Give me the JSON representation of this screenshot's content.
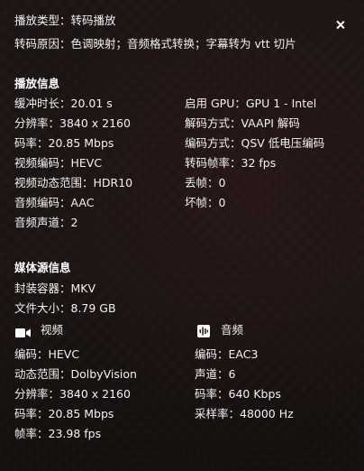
{
  "header": {
    "playback_type": "播放类型：转码播放",
    "transcode_reason": "转码原因：色调映射；音频格式转换；字幕转为 vtt 切片"
  },
  "playback_info": {
    "title": "播放信息",
    "left": [
      "缓冲时长：20.01 s",
      "分辨率：3840 x 2160",
      "码率：20.85 Mbps",
      "视频编码：HEVC",
      "视频动态范围：HDR10",
      "音频编码：AAC",
      "音频声道：2"
    ],
    "right": [
      "启用 GPU：GPU 1 - Intel",
      "解码方式：VAAPI 解码",
      "编码方式：QSV 低电压编码",
      "转码帧率：32 fps",
      "丢帧：0",
      "坏帧：0"
    ]
  },
  "media_source": {
    "title": "媒体源信息",
    "container": "封装容器：MKV",
    "file_size": "文件大小：8.79 GB",
    "video": {
      "label": "视频",
      "icon": "video-camera-icon",
      "rows": [
        "编码：HEVC",
        "动态范围：DolbyVision",
        "分辨率：3840 x 2160",
        "码率：20.85 Mbps",
        "帧率：23.98 fps"
      ]
    },
    "audio": {
      "label": "音频",
      "icon": "audio-waveform-icon",
      "rows": [
        "编码：EAC3",
        "声道：6",
        "码率：640 Kbps",
        "采样率：48000 Hz"
      ]
    }
  },
  "close_icon": "close-icon"
}
